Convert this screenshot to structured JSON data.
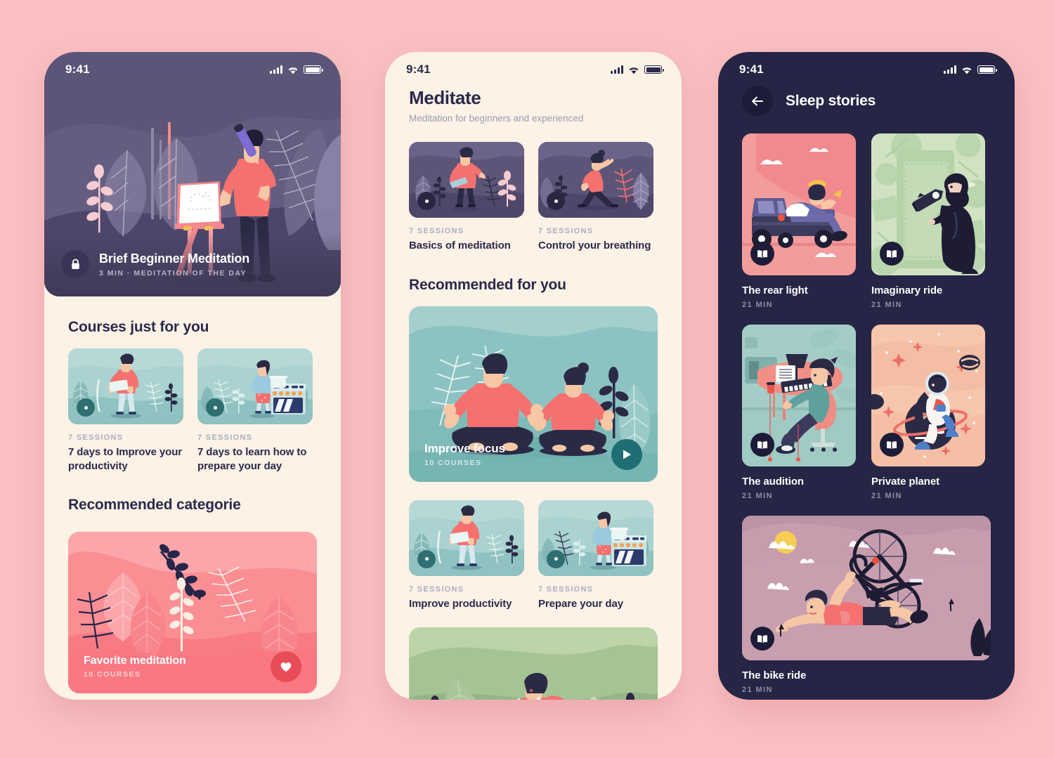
{
  "background_color": "#F9BFC1",
  "phone1": {
    "name": "home-screen",
    "background_color": "#FDF2E6",
    "status_bar": {
      "time": "9:41",
      "signal_icon": "signal-bars-icon",
      "wifi_icon": "wifi-icon",
      "battery_icon": "battery-icon"
    },
    "hero": {
      "background_color": "#5C5577",
      "lock_icon": "lock-icon",
      "title": "Brief Beginner Meditation",
      "subtitle": "3 MIN · MEDITATION OF THE DAY"
    },
    "courses_section": {
      "heading": "Courses just for you",
      "cards": [
        {
          "meta": "7 SESSIONS",
          "title": "7 days to Improve your productivity",
          "play_icon": "play-icon"
        },
        {
          "meta": "7 SESSIONS",
          "title": "7 days to learn how to prepare your day",
          "play_icon": "play-icon"
        }
      ]
    },
    "recommended_section": {
      "heading": "Recommended categorie",
      "card": {
        "title": "Favorite meditation",
        "meta": "10 COURSES",
        "heart_icon": "heart-icon",
        "background_color": "#FA8288",
        "button_color": "#E84C56"
      }
    }
  },
  "phone2": {
    "name": "meditate-screen",
    "background_color": "#FDF2E6",
    "status_bar": {
      "time": "9:41",
      "signal_icon": "signal-bars-icon",
      "wifi_icon": "wifi-icon",
      "battery_icon": "battery-icon"
    },
    "header": {
      "title": "Meditate",
      "subtitle": "Meditation for beginners and experienced"
    },
    "top_cards": [
      {
        "meta": "7 SESSIONS",
        "title": "Basics of meditation",
        "play_icon": "play-icon"
      },
      {
        "meta": "7 SESSIONS",
        "title": "Control your breathing",
        "play_icon": "play-icon"
      }
    ],
    "recommended_section": {
      "heading": "Recommended for you",
      "featured": {
        "title": "Improve focus",
        "meta": "10 COURSES",
        "play_icon": "play-icon",
        "background_color": "#7FBFC0"
      },
      "cards": [
        {
          "meta": "7 SESSIONS",
          "title": "Improve productivity",
          "play_icon": "play-icon"
        },
        {
          "meta": "7 SESSIONS",
          "title": "Prepare your day",
          "play_icon": "play-icon"
        }
      ]
    }
  },
  "phone3": {
    "name": "sleep-stories-screen",
    "background_color": "#262545",
    "status_bar": {
      "time": "9:41",
      "signal_icon": "signal-bars-icon",
      "wifi_icon": "wifi-icon",
      "battery_icon": "battery-icon"
    },
    "header": {
      "back_icon": "arrow-left-icon",
      "title": "Sleep stories"
    },
    "stories": [
      {
        "title": "The rear light",
        "duration": "21 MIN",
        "book_icon": "book-icon",
        "background_color": "#F39C9C"
      },
      {
        "title": "Imaginary ride",
        "duration": "21 MIN",
        "book_icon": "book-icon",
        "background_color": "#BBD6AE"
      },
      {
        "title": "The audition",
        "duration": "21 MIN",
        "book_icon": "book-icon",
        "background_color": "#AFD3CE"
      },
      {
        "title": "Private planet",
        "duration": "21 MIN",
        "book_icon": "book-icon",
        "background_color": "#F6C6AD"
      },
      {
        "title": "The bike ride",
        "duration": "21 MIN",
        "book_icon": "book-icon",
        "background_color": "#C39BAE"
      }
    ]
  }
}
